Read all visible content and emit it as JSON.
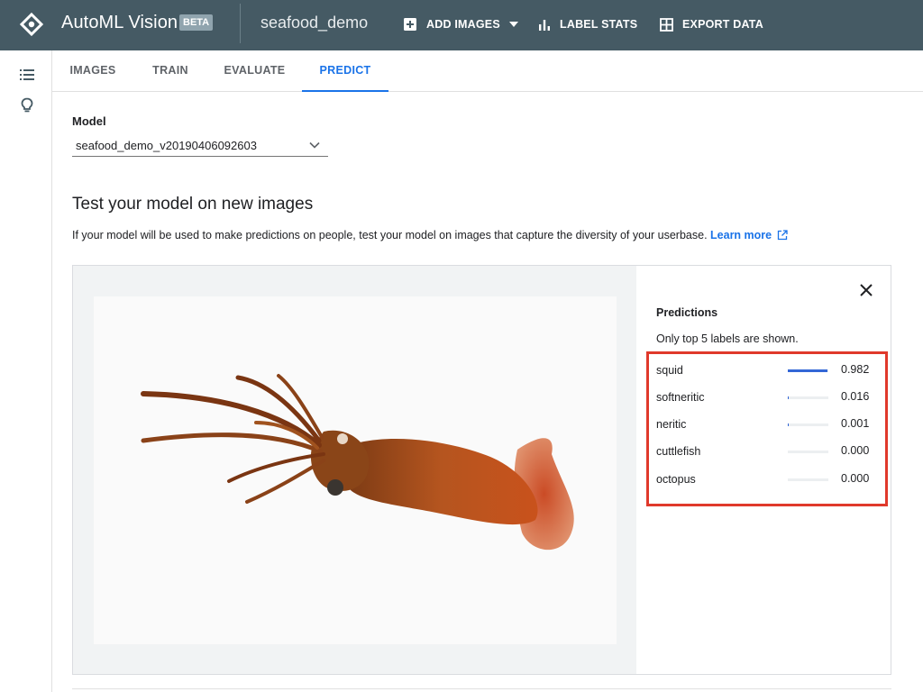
{
  "header": {
    "app_title": "AutoML Vision",
    "beta_badge": "BETA",
    "project": "seafood_demo",
    "actions": [
      {
        "label": "ADD IMAGES",
        "icon": "add-box-icon"
      },
      {
        "label": "LABEL STATS",
        "icon": "bar-chart-icon"
      },
      {
        "label": "EXPORT DATA",
        "icon": "grid-icon"
      }
    ],
    "colors": {
      "bar": "#455a64",
      "accent": "#1a73e8"
    }
  },
  "rail": {
    "icons": [
      "list-icon",
      "lightbulb-icon"
    ]
  },
  "tabs": [
    {
      "label": "IMAGES",
      "active": false
    },
    {
      "label": "TRAIN",
      "active": false
    },
    {
      "label": "EVALUATE",
      "active": false
    },
    {
      "label": "PREDICT",
      "active": true
    }
  ],
  "model": {
    "label": "Model",
    "selected": "seafood_demo_v20190406092603"
  },
  "test": {
    "title": "Test your model on new images",
    "description": "If your model will be used to make predictions on people, test your model on images that capture the diversity of your userbase.",
    "learn_more": "Learn more"
  },
  "predictions": {
    "title": "Predictions",
    "note": "Only top 5 labels are shown.",
    "items": [
      {
        "label": "squid",
        "score": "0.982",
        "fraction": 0.982
      },
      {
        "label": "softneritic",
        "score": "0.016",
        "fraction": 0.016
      },
      {
        "label": "neritic",
        "score": "0.001",
        "fraction": 0.001
      },
      {
        "label": "cuttlefish",
        "score": "0.000",
        "fraction": 0
      },
      {
        "label": "octopus",
        "score": "0.000",
        "fraction": 0
      }
    ],
    "highlight_color": "#e0392b"
  }
}
